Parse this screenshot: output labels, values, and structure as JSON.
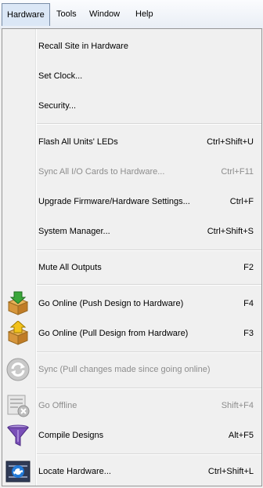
{
  "menubar": {
    "items": [
      {
        "label": "Hardware",
        "active": true
      },
      {
        "label": "Tools"
      },
      {
        "label": "Window"
      },
      {
        "label": "Help"
      }
    ]
  },
  "menu": {
    "items": [
      {
        "label": "Recall Site in Hardware",
        "shortcut": "",
        "enabled": true,
        "icon": ""
      },
      {
        "label": "Set Clock...",
        "shortcut": "",
        "enabled": true,
        "icon": ""
      },
      {
        "label": "Security...",
        "shortcut": "",
        "enabled": true,
        "icon": ""
      },
      {
        "label": "Flash All Units' LEDs",
        "shortcut": "Ctrl+Shift+U",
        "enabled": true,
        "icon": ""
      },
      {
        "label": "Sync All I/O Cards to Hardware...",
        "shortcut": "Ctrl+F11",
        "enabled": false,
        "icon": ""
      },
      {
        "label": "Upgrade Firmware/Hardware Settings...",
        "shortcut": "Ctrl+F",
        "enabled": true,
        "icon": ""
      },
      {
        "label": "System Manager...",
        "shortcut": "Ctrl+Shift+S",
        "enabled": true,
        "icon": ""
      },
      {
        "label": "Mute All Outputs",
        "shortcut": "F2",
        "enabled": true,
        "icon": ""
      },
      {
        "label": "Go Online (Push Design to Hardware)",
        "shortcut": "F4",
        "enabled": true,
        "icon": "box-push-icon"
      },
      {
        "label": "Go Online (Pull Design from Hardware)",
        "shortcut": "F3",
        "enabled": true,
        "icon": "box-pull-icon"
      },
      {
        "label": "Sync (Pull changes made since going online)",
        "shortcut": "",
        "enabled": false,
        "icon": "sync-icon"
      },
      {
        "label": "Go Offline",
        "shortcut": "Shift+F4",
        "enabled": false,
        "icon": "go-offline-icon"
      },
      {
        "label": "Compile Designs",
        "shortcut": "Alt+F5",
        "enabled": true,
        "icon": "funnel-icon"
      },
      {
        "label": "Locate Hardware...",
        "shortcut": "Ctrl+Shift+L",
        "enabled": true,
        "icon": "locate-hardware-icon"
      }
    ]
  },
  "colors": {
    "menubar_active_bg": "#dbe7f6",
    "menu_bg": "#f0f0f0",
    "disabled_text": "#8d8d8d",
    "green_arrow": "#3aa63a",
    "yellow_arrow": "#f2c21a",
    "funnel": "#7a4fb8"
  }
}
